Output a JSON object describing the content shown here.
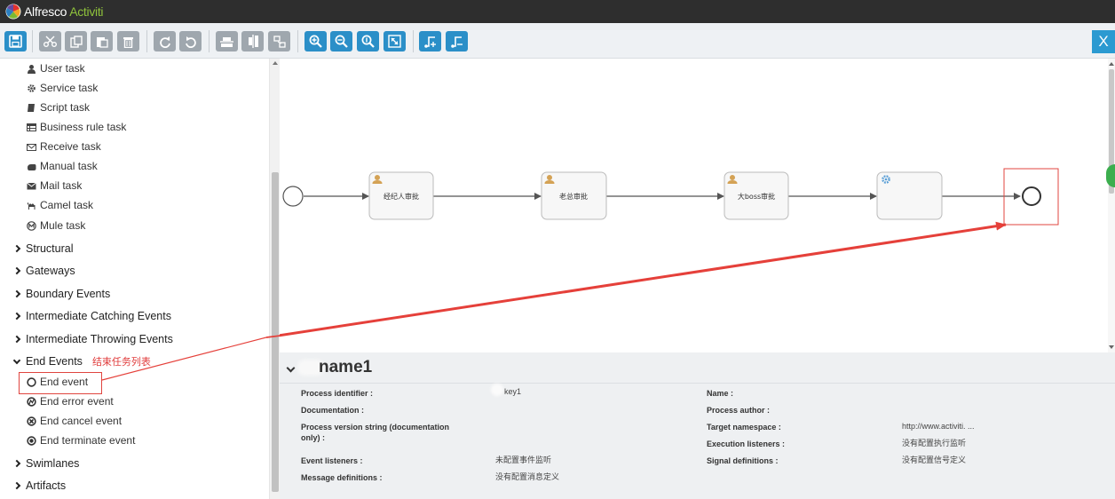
{
  "app": {
    "brand_primary": "Alfresco",
    "brand_secondary": "Activiti",
    "accent_color": "#2b8fc8",
    "highlight_color": "#e0453f"
  },
  "toolbar": {
    "buttons": [
      {
        "name": "save-icon"
      },
      {
        "name": "cut-icon"
      },
      {
        "name": "copy-icon"
      },
      {
        "name": "paste-icon"
      },
      {
        "name": "delete-icon"
      },
      {
        "name": "redo-icon"
      },
      {
        "name": "undo-icon"
      },
      {
        "name": "align-horizontal-icon"
      },
      {
        "name": "align-vertical-icon"
      },
      {
        "name": "same-size-icon"
      },
      {
        "name": "zoom-in-icon"
      },
      {
        "name": "zoom-out-icon"
      },
      {
        "name": "zoom-actual-icon"
      },
      {
        "name": "zoom-fit-icon"
      },
      {
        "name": "bendpoint-add-icon"
      },
      {
        "name": "bendpoint-remove-icon"
      }
    ],
    "close_label": "X"
  },
  "palette": {
    "tasks": [
      {
        "label": "User task",
        "icon": "user-icon"
      },
      {
        "label": "Service task",
        "icon": "gear-icon"
      },
      {
        "label": "Script task",
        "icon": "script-icon"
      },
      {
        "label": "Business rule task",
        "icon": "table-icon"
      },
      {
        "label": "Receive task",
        "icon": "envelope-open-icon"
      },
      {
        "label": "Manual task",
        "icon": "hand-icon"
      },
      {
        "label": "Mail task",
        "icon": "envelope-icon"
      },
      {
        "label": "Camel task",
        "icon": "camel-icon"
      },
      {
        "label": "Mule task",
        "icon": "mule-icon"
      }
    ],
    "groups_before": [
      "Structural",
      "Gateways",
      "Boundary Events",
      "Intermediate Catching Events",
      "Intermediate Throwing Events"
    ],
    "end_events": {
      "label": "End Events",
      "note": "结束任务列表",
      "items": [
        {
          "label": "End event",
          "icon": "circle-icon"
        },
        {
          "label": "End error event",
          "icon": "error-circle-icon"
        },
        {
          "label": "End cancel event",
          "icon": "cancel-circle-icon"
        },
        {
          "label": "End terminate event",
          "icon": "terminate-circle-icon"
        }
      ]
    },
    "groups_after": [
      "Swimlanes",
      "Artifacts"
    ]
  },
  "diagram": {
    "tasks": [
      {
        "label": "经纪人审批",
        "type": "user"
      },
      {
        "label": "老总审批",
        "type": "user"
      },
      {
        "label": "大boss审批",
        "type": "user"
      },
      {
        "label": "",
        "type": "service"
      }
    ]
  },
  "properties": {
    "title": "name1",
    "left": [
      {
        "label": "Process identifier :",
        "value": "key1"
      },
      {
        "label": "Documentation :",
        "value": ""
      },
      {
        "label": "Process version string (documentation only) :",
        "value": ""
      },
      {
        "label": "Event listeners :",
        "value": "未配置事件监听"
      },
      {
        "label": "Message definitions :",
        "value": "没有配置消息定义"
      }
    ],
    "right": [
      {
        "label": "Name :",
        "value": ""
      },
      {
        "label": "Process author :",
        "value": ""
      },
      {
        "label": "Target namespace :",
        "value": "http://www.activiti. ..."
      },
      {
        "label": "Execution listeners :",
        "value": "没有配置执行监听"
      },
      {
        "label": "Signal definitions :",
        "value": "没有配置信号定义"
      }
    ]
  }
}
